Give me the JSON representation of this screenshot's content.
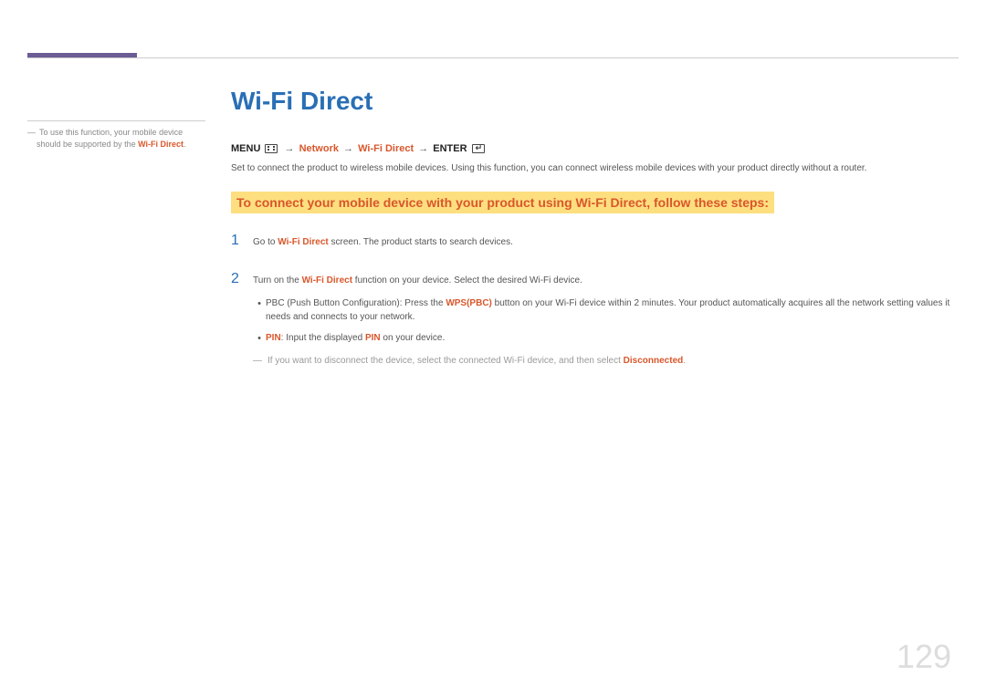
{
  "sidebar": {
    "note_prefix": "To use this function, your mobile device should be supported by the ",
    "note_red": "Wi-Fi Direct",
    "note_suffix": "."
  },
  "main": {
    "title": "Wi-Fi Direct",
    "breadcrumb": {
      "menu_label": "MENU",
      "arrow": "→",
      "path1": "Network",
      "path2": "Wi-Fi Direct",
      "enter_label": "ENTER"
    },
    "intro": "Set to connect the product to wireless mobile devices. Using this function, you can connect wireless mobile devices with your product directly without a router.",
    "highlight_heading": "To connect your mobile device with your product using Wi-Fi Direct, follow these steps:",
    "steps": [
      {
        "num": "1",
        "text_before": "Go to ",
        "text_red": "Wi-Fi Direct",
        "text_after": " screen. The product starts to search devices."
      },
      {
        "num": "2",
        "text_before": "Turn on the ",
        "text_red": "Wi-Fi Direct",
        "text_after": " function on your device. Select the desired Wi-Fi device."
      }
    ],
    "bullets": [
      {
        "before": "PBC (Push Button Configuration): Press the ",
        "red": "WPS(PBC)",
        "after": " button on your Wi-Fi device within 2 minutes. Your product automatically acquires all the network setting values it needs and connects to your network."
      },
      {
        "before_red": "PIN",
        "mid": ": Input the displayed ",
        "red2": "PIN",
        "after": " on your device."
      }
    ],
    "footnote": {
      "before": "If you want to disconnect the device, select the connected Wi-Fi device, and then select ",
      "red": "Disconnected",
      "after": "."
    }
  },
  "page_number": "129"
}
